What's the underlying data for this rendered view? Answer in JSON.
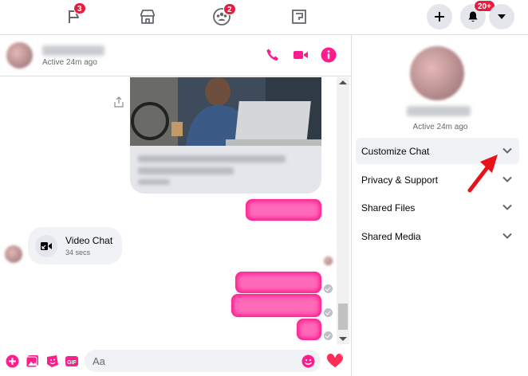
{
  "topnav": {
    "flag_badge": "3",
    "groups_badge": "2",
    "notifications_badge": "20+"
  },
  "conversation": {
    "status": "Active 24m ago"
  },
  "messages": {
    "video_chat_title": "Video Chat",
    "video_chat_duration": "34 secs"
  },
  "composer": {
    "placeholder": "Aa"
  },
  "right_panel": {
    "status": "Active 24m ago",
    "items": [
      {
        "label": "Customize Chat"
      },
      {
        "label": "Privacy & Support"
      },
      {
        "label": "Shared Files"
      },
      {
        "label": "Shared Media"
      }
    ]
  },
  "colors": {
    "accent": "#ff1d8e",
    "badge": "#e41e3f",
    "annotation_arrow": "#e8121a"
  }
}
